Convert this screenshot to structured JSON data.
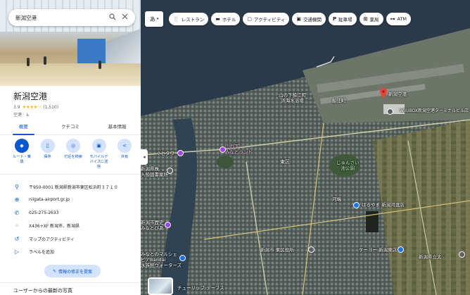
{
  "search": {
    "value": "新潟空港"
  },
  "place": {
    "title": "新潟空港",
    "rating": "3.9",
    "stars": "★★★★☆",
    "reviews": "(1,510)",
    "category": "空港 · ♿"
  },
  "tabs": [
    {
      "label": "概要"
    },
    {
      "label": "クチコミ"
    },
    {
      "label": "基本情報"
    }
  ],
  "actions": [
    {
      "label": "ルート・乗\n換",
      "icon": "◆"
    },
    {
      "label": "保存",
      "icon": "▯"
    },
    {
      "label": "付近を検索",
      "icon": "◎"
    },
    {
      "label": "モバイルデ\nバイスに送\n信",
      "icon": "▣"
    },
    {
      "label": "共有",
      "icon": "<"
    }
  ],
  "info": [
    {
      "icon": "⚲",
      "text": "〒950-0001 新潟県新潟市東区松浜町３７１０"
    },
    {
      "icon": "⊕",
      "text": "niigata-airport.gr.jp"
    },
    {
      "icon": "✆",
      "text": "025-275-2633"
    },
    {
      "icon": "⁘",
      "text": "X436+XF 新潟市、新潟県"
    },
    {
      "icon": "↺",
      "text": "マップのアクティビティ"
    },
    {
      "icon": "▷",
      "text": "ラベルを追加"
    }
  ],
  "suggest_edit": "情報の修正を提案",
  "photos_heading": "ユーザーからの最新の写真",
  "map": {
    "lang": "あ",
    "chips": [
      {
        "icon": "🍴",
        "label": "レストラン"
      },
      {
        "icon": "▬",
        "label": "ホテル"
      },
      {
        "icon": "▢",
        "label": "アクティビティ"
      },
      {
        "icon": "▣",
        "label": "交通機関"
      },
      {
        "icon": "P",
        "label": "駐車場"
      },
      {
        "icon": "⊞",
        "label": "薬局"
      },
      {
        "icon": "⊶",
        "label": "ATM"
      }
    ],
    "labels": {
      "airport": "新潟空港",
      "wiiubox": "WiiUBOX新潟空港ターミナルビル店",
      "yamanoshita": "山の下船江町\n浜海水浴場",
      "funae": "船江町",
      "landmark": "山の下\nみなとランド",
      "east_ward": "東区",
      "junsai": "じゅんさい\n池公園",
      "kawabata": "河端",
      "halmeck": "はるやま 新潟河渡店",
      "tower": "ぐとタワー",
      "kanjo": "新潟県株\n入船図書案所",
      "higashi_office": "新潟市 東区役所",
      "keion": "ケーヨー 新潟東店",
      "minato": "新潟市歴史\nみなとぴあ",
      "marine": "みなとのマルシェ\nピアBandai\n水族館ウォーターズ",
      "sales": "チューリップ デーフス",
      "hospital": "新潟県立太"
    }
  }
}
